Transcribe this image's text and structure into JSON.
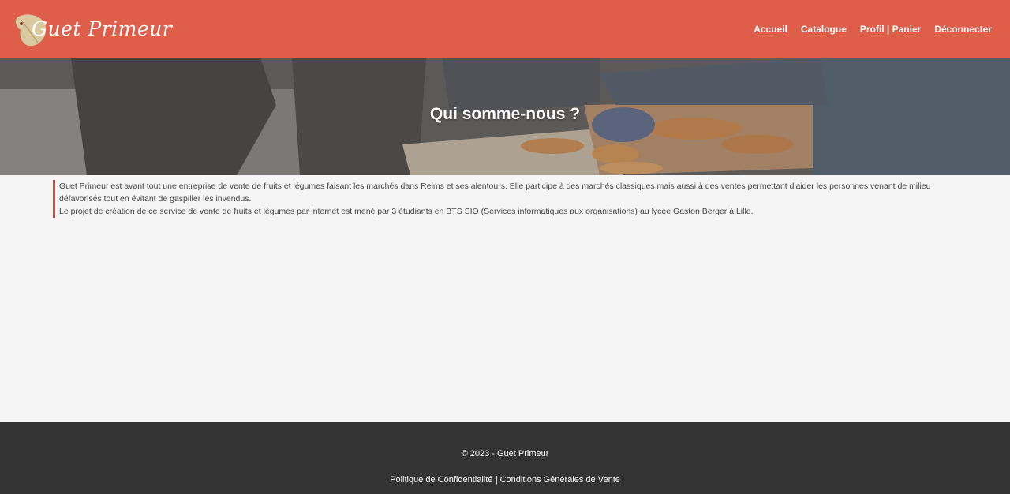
{
  "header": {
    "logo_text": "Guet Primeur",
    "bg_color": "#de5e4a",
    "nav": [
      {
        "label": "Accueil"
      },
      {
        "label": "Catalogue"
      },
      {
        "label": "Profil | Panier"
      },
      {
        "label": "Déconnecter"
      }
    ]
  },
  "hero": {
    "title": "Qui somme-nous ?"
  },
  "about": {
    "paragraph1": "Guet Primeur est avant tout une entreprise de vente de fruits et légumes faisant les marchés dans Reims et ses alentours. Elle participe à des marchés classiques mais aussi à des ventes permettant d'aider les personnes venant de milieu défavorisés tout en évitant de gaspiller les invendus.",
    "paragraph2": "Le projet de création de ce service de vente de fruits et légumes par internet est mené par 3 étudiants en BTS SIO (Services informatiques aux organisations) au lycée Gaston Berger à Lille.",
    "accent_color": "#c84b3a"
  },
  "footer": {
    "copyright": "© 2023 - Guet Primeur",
    "privacy_label": "Politique de Confidentialité",
    "separator": "|",
    "terms_label": "Conditions Générales de Vente",
    "bg_color": "#333333"
  }
}
